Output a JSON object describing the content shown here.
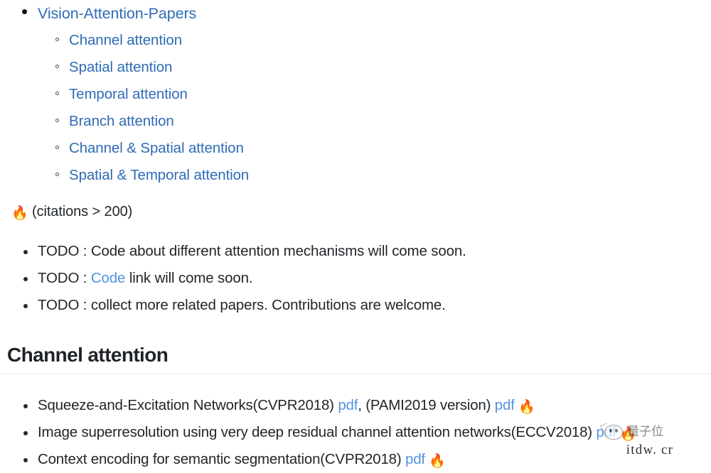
{
  "toc": {
    "top_item": "Vision-Attention-Papers",
    "sub_items": [
      "Channel attention",
      "Spatial attention",
      "Temporal attention",
      "Branch attention",
      "Channel & Spatial attention",
      "Spatial & Temporal attention"
    ]
  },
  "citations": {
    "fire_icon": "fire-icon",
    "fire_glyph": "🔥",
    "text": "(citations > 200)"
  },
  "todos": [
    {
      "before": "TODO : Code about different attention mechanisms will come soon.",
      "link": "",
      "after": ""
    },
    {
      "before": "TODO : ",
      "link": "Code",
      "after": " link will come soon."
    },
    {
      "before": "TODO : collect more related papers. Contributions are welcome.",
      "link": "",
      "after": ""
    }
  ],
  "section": {
    "heading": "Channel attention"
  },
  "papers": [
    {
      "title": "Squeeze-and-Excitation Networks(CVPR2018)",
      "link1": "pdf",
      "mid": ", (PAMI2019 version)",
      "link2": "pdf",
      "fire": "🔥"
    },
    {
      "title": "Image superresolution using very deep residual channel attention networks(ECCV2018)",
      "link1": "pdf",
      "mid": "",
      "link2": "",
      "fire": "🔥"
    },
    {
      "title": "Context encoding for semantic segmentation(CVPR2018)",
      "link1": "pdf",
      "mid": "",
      "link2": "",
      "fire": "🔥"
    }
  ],
  "watermark": {
    "brand_cn": "量子位",
    "site": "itdw. cr",
    "fire": "🔥"
  },
  "colors": {
    "link": "#2f6cb5",
    "inline_link": "#5392dd",
    "text": "#22262a",
    "heading": "#1f2328",
    "rule": "#e6e8ea",
    "background": "#ffffff"
  }
}
